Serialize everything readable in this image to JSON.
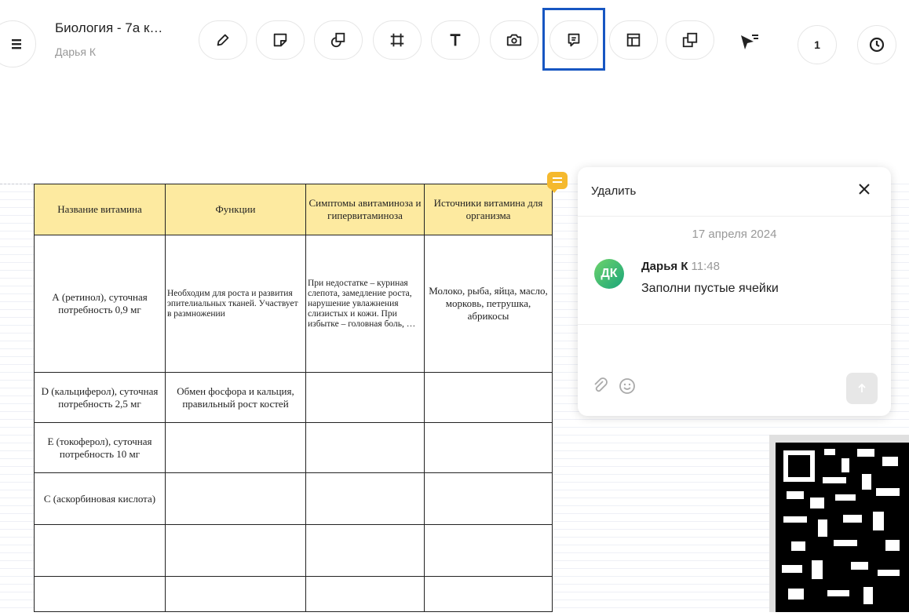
{
  "header": {
    "title": "Биология - 7а к…",
    "subtitle": "Дарья К",
    "page_count": "1"
  },
  "toolbar": {
    "tools": [
      "menu-icon",
      "pencil-icon",
      "sticky-note-icon",
      "shapes-icon",
      "frame-icon",
      "text-icon",
      "camera-icon",
      "comment-icon",
      "table-icon",
      "duplicate-icon",
      "pointer-icon",
      "history-icon"
    ]
  },
  "table": {
    "headers": [
      "Название витамина",
      "Функции",
      "Симптомы авитаминоза и гипервитаминоза",
      "Источники витамина для организма"
    ],
    "rows": [
      [
        "А (ретинол), суточная потребность 0,9 мг",
        "Необходим для роста и развития эпителиальных тканей. Участвует в размножении",
        "При недостатке – куриная слепота, замедление роста, нарушение увлажнения слизистых и кожи. При избытке – головная боль, …",
        "Молоко, рыба, яйца, масло, морковь, петрушка, абрикосы"
      ],
      [
        "D (кальциферол), суточная потребность 2,5 мг",
        "Обмен фосфора и кальция, правильный рост костей",
        "",
        ""
      ],
      [
        "E (токоферол), суточная потребность 10 мг",
        "",
        "",
        ""
      ],
      [
        "С (аскорбиновая кислота)",
        "",
        "",
        ""
      ],
      [
        "",
        "",
        "",
        ""
      ],
      [
        "",
        "",
        "",
        ""
      ]
    ]
  },
  "comment_panel": {
    "delete_label": "Удалить",
    "close_icon": "close-icon",
    "date": "17 апреля 2024",
    "avatar_initials": "ДК",
    "author": "Дарья К",
    "time": "11:48",
    "message": "Заполни пустые ячейки",
    "colors": {
      "badge": "#f5b92e",
      "highlight": "#1756c2",
      "header_fill": "#fdeaa0"
    }
  }
}
